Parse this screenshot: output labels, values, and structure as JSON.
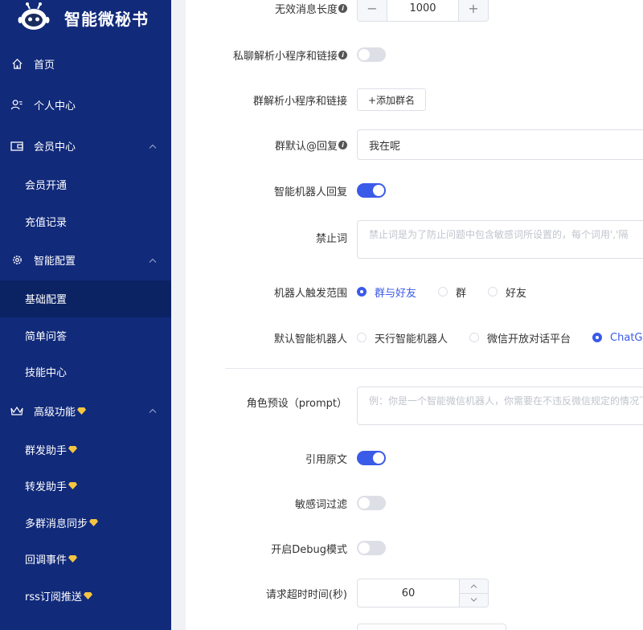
{
  "app": {
    "title": "智能微秘书"
  },
  "sidebar": {
    "items": [
      {
        "label": "首页",
        "icon": "home-icon"
      },
      {
        "label": "个人中心",
        "icon": "user-icon"
      },
      {
        "label": "会员中心",
        "icon": "wallet-icon",
        "expanded": true,
        "children": [
          {
            "label": "会员开通"
          },
          {
            "label": "充值记录"
          }
        ]
      },
      {
        "label": "智能配置",
        "icon": "gear-icon",
        "expanded": true,
        "children": [
          {
            "label": "基础配置",
            "active": true
          },
          {
            "label": "简单问答"
          },
          {
            "label": "技能中心"
          }
        ]
      },
      {
        "label": "高级功能",
        "icon": "crown-icon",
        "expanded": true,
        "children": [
          {
            "label": "群发助手"
          },
          {
            "label": "转发助手"
          },
          {
            "label": "多群消息同步"
          },
          {
            "label": "回调事件"
          },
          {
            "label": "rss订阅推送"
          }
        ]
      }
    ]
  },
  "form": {
    "invalid_len": {
      "label": "无效消息长度",
      "value": "1000",
      "minus": "−",
      "plus": "+"
    },
    "private_parse": {
      "label": "私聊解析小程序和链接",
      "on": false
    },
    "group_parse": {
      "label": "群解析小程序和链接",
      "button": "+添加群名"
    },
    "group_default_reply": {
      "label": "群默认@回复",
      "value": "我在呢"
    },
    "robot_reply": {
      "label": "智能机器人回复",
      "on": true
    },
    "forbidden_words": {
      "label": "禁止词",
      "placeholder": "禁止词是为了防止问题中包含敏感词所设置的，每个词用','隔"
    },
    "trigger_scope": {
      "label": "机器人触发范围",
      "options": [
        "群与好友",
        "群",
        "好友"
      ],
      "selected": 0
    },
    "default_robot": {
      "label": "默认智能机器人",
      "options": [
        "天行智能机器人",
        "微信开放对话平台",
        "ChatGPT"
      ],
      "selected": 2
    },
    "role_prompt": {
      "label": "角色预设（prompt）",
      "placeholder": "例：你是一个智能微信机器人，你需要在不违反微信规定的情况下"
    },
    "quote_original": {
      "label": "引用原文",
      "on": true
    },
    "sensitive_filter": {
      "label": "敏感词过滤",
      "on": false
    },
    "debug_mode": {
      "label": "开启Debug模式",
      "on": false
    },
    "timeout": {
      "label": "请求超时时间(秒)",
      "value": "60"
    }
  },
  "colors": {
    "sidebar": "#112a7a",
    "sidebar_active": "#0b2263",
    "accent": "#3a5ae8"
  }
}
